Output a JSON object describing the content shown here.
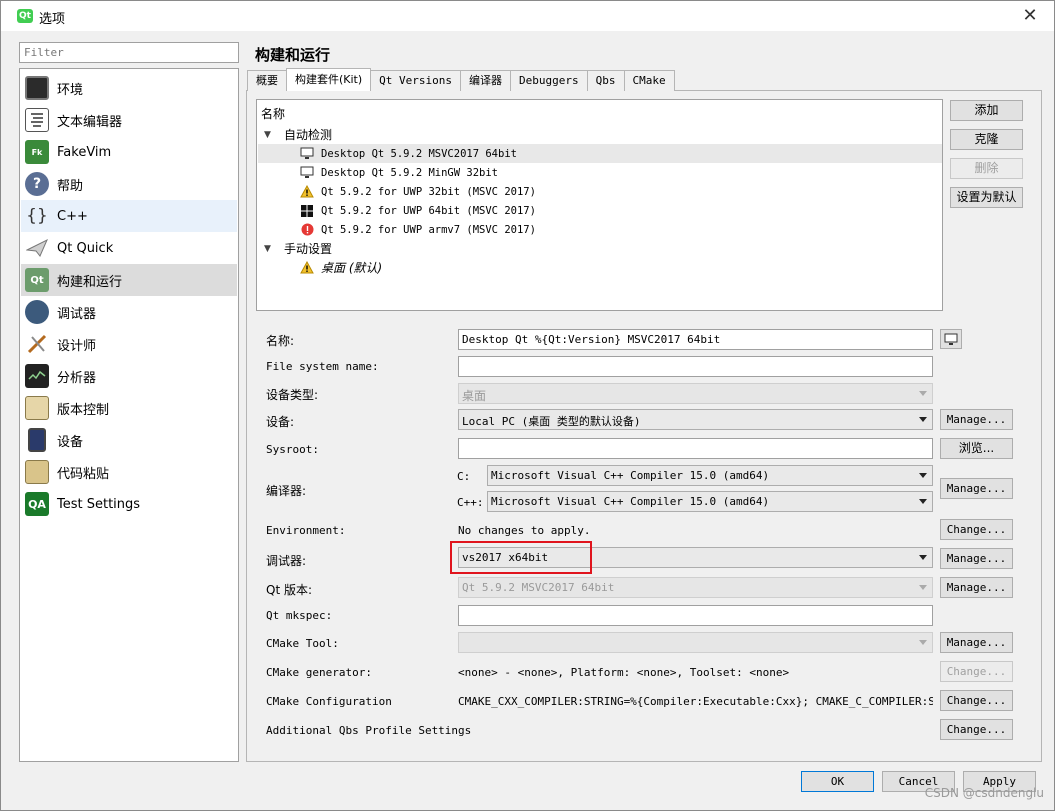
{
  "window": {
    "title": "选项",
    "app_icon_text": "Qt"
  },
  "sidebar": {
    "filter_placeholder": "Filter",
    "items": [
      {
        "label": "环境",
        "icon": "monitor-icon"
      },
      {
        "label": "文本编辑器",
        "icon": "text-editor-icon"
      },
      {
        "label": "FakeVim",
        "icon": "fakevim-icon"
      },
      {
        "label": "帮助",
        "icon": "help-icon"
      },
      {
        "label": "C++",
        "icon": "braces-icon"
      },
      {
        "label": "Qt Quick",
        "icon": "paper-plane-icon"
      },
      {
        "label": "构建和运行",
        "icon": "build-run-icon"
      },
      {
        "label": "调试器",
        "icon": "debugger-icon"
      },
      {
        "label": "设计师",
        "icon": "designer-icon"
      },
      {
        "label": "分析器",
        "icon": "analyzer-icon"
      },
      {
        "label": "版本控制",
        "icon": "version-control-icon"
      },
      {
        "label": "设备",
        "icon": "device-icon"
      },
      {
        "label": "代码粘贴",
        "icon": "code-paste-icon"
      },
      {
        "label": "Test Settings",
        "icon": "qa-icon"
      }
    ],
    "qa_icon_text": "QA"
  },
  "main": {
    "title": "构建和运行",
    "tabs": [
      "概要",
      "构建套件(Kit)",
      "Qt Versions",
      "编译器",
      "Debuggers",
      "Qbs",
      "CMake"
    ],
    "tree": {
      "header": "名称",
      "group_auto": "自动检测",
      "auto_kits": [
        {
          "label": "Desktop Qt 5.9.2 MSVC2017 64bit",
          "icon": "monitor-icon"
        },
        {
          "label": "Desktop Qt 5.9.2 MinGW 32bit",
          "icon": "monitor-icon"
        },
        {
          "label": "Qt 5.9.2 for UWP 32bit (MSVC 2017)",
          "icon": "warning-icon"
        },
        {
          "label": "Qt 5.9.2 for UWP 64bit (MSVC 2017)",
          "icon": "windows-icon"
        },
        {
          "label": "Qt 5.9.2 for UWP armv7 (MSVC 2017)",
          "icon": "error-icon"
        }
      ],
      "group_manual": "手动设置",
      "manual_kits": [
        {
          "label": "桌面 (默认)",
          "icon": "warning-icon"
        }
      ]
    },
    "side_buttons": {
      "add": "添加",
      "clone": "克隆",
      "remove": "删除",
      "set_default": "设置为默认"
    },
    "form": {
      "name_label": "名称:",
      "name_value": "Desktop Qt %{Qt:Version} MSVC2017 64bit",
      "fs_name_label": "File system name:",
      "fs_name_value": "",
      "device_type_label": "设备类型:",
      "device_type_value": "桌面",
      "device_label": "设备:",
      "device_value": "Local PC (桌面 类型的默认设备)",
      "sysroot_label": "Sysroot:",
      "sysroot_value": "",
      "compiler_label": "编译器:",
      "compiler_c_label": "C:",
      "compiler_c_value": "Microsoft Visual C++ Compiler 15.0 (amd64)",
      "compiler_cxx_label": "C++:",
      "compiler_cxx_value": "Microsoft Visual C++ Compiler 15.0 (amd64)",
      "environment_label": "Environment:",
      "environment_value": "No changes to apply.",
      "debugger_label": "调试器:",
      "debugger_value": "vs2017 x64bit",
      "qt_version_label": "Qt 版本:",
      "qt_version_value": "Qt 5.9.2 MSVC2017 64bit",
      "qt_mkspec_label": "Qt mkspec:",
      "qt_mkspec_value": "",
      "cmake_tool_label": "CMake Tool:",
      "cmake_tool_value": "",
      "cmake_generator_label": "CMake generator:",
      "cmake_generator_value": "<none> - <none>, Platform: <none>, Toolset: <none>",
      "cmake_config_label": "CMake Configuration",
      "cmake_config_value": "CMAKE_CXX_COMPILER:STRING=%{Compiler:Executable:Cxx}; CMAKE_C_COMPILER:STRING=…",
      "qbs_profile_label": "Additional Qbs Profile Settings"
    },
    "row_buttons": {
      "manage": "Manage...",
      "browse": "浏览...",
      "change": "Change..."
    }
  },
  "footer": {
    "ok": "OK",
    "cancel": "Cancel",
    "apply": "Apply"
  },
  "watermark": "CSDN @csdndenglu"
}
